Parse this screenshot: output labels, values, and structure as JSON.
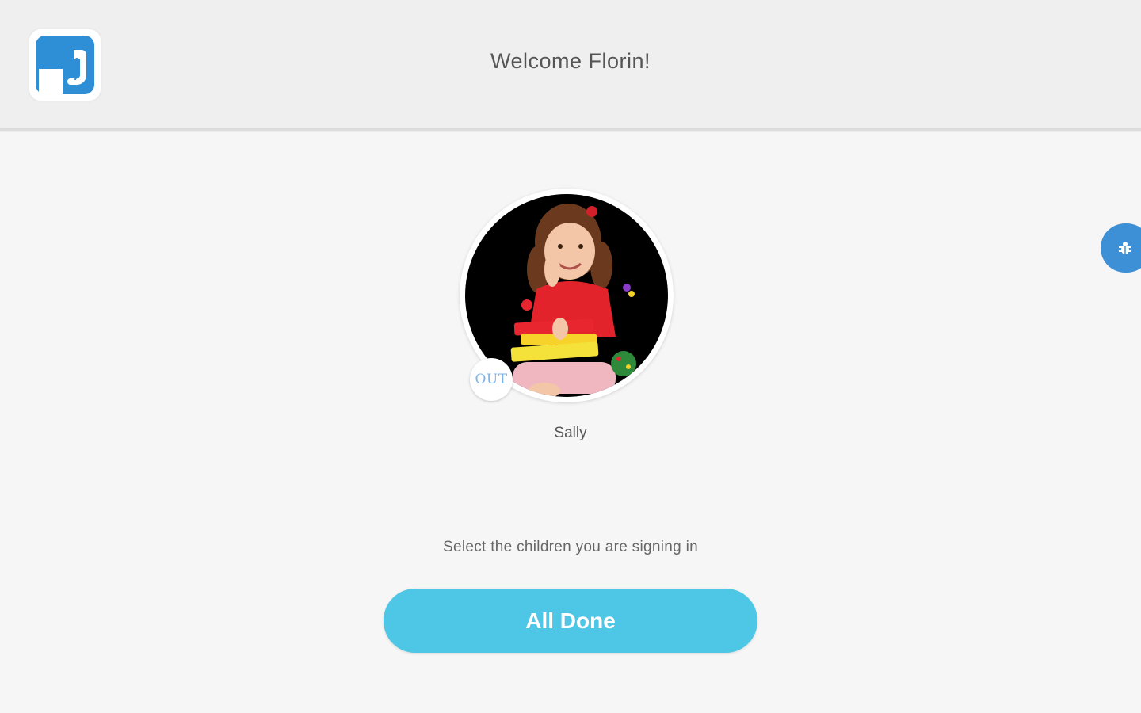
{
  "header": {
    "logo_icon": "elephant-logo-icon",
    "welcome_text": "Welcome Florin!"
  },
  "floating_action": {
    "icon": "bug-icon",
    "color": "#3d8fd6"
  },
  "children": [
    {
      "name": "Sally",
      "status_badge": "OUT",
      "photo": "child-photo"
    }
  ],
  "instruction_text": "Select the children you are signing in",
  "done_button": {
    "label": "All Done",
    "color": "#4ec6e5"
  },
  "colors": {
    "brand_blue": "#2f8fd6",
    "badge_text": "#7db3e8"
  }
}
